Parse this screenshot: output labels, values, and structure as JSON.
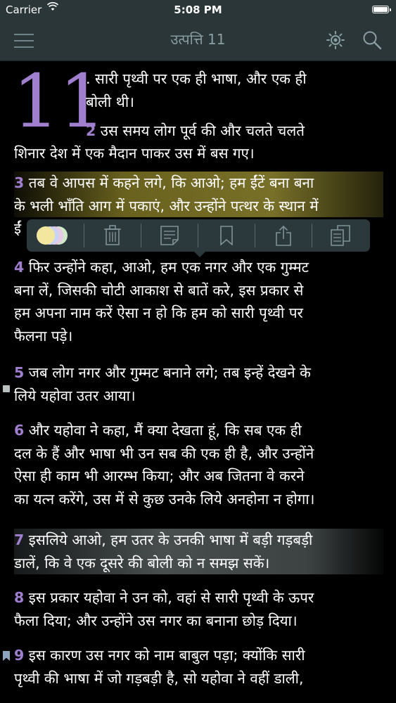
{
  "status_bar": {
    "carrier": "Carrier",
    "time": "5:08 PM"
  },
  "nav": {
    "title": "उत्पत्ति 11",
    "icons": [
      "menu-icon",
      "brightness-icon",
      "search-icon"
    ]
  },
  "chapter_number": "11",
  "verses": {
    "v1": {
      "lines": [
        ". सारी पृथ्वी पर एक ही भाषा, और एक ही",
        "बोली थी।"
      ]
    },
    "v2": {
      "num": "2",
      "lines": [
        " उस समय लोग पूर्व की और चलते चलते",
        "शिनार देश में एक मैदान पाकर उस में बस गए।"
      ]
    },
    "v3": {
      "num": "3",
      "lines": [
        " तब वे आपस में कहने लगे, कि आओ; हम ईंटें बना बना",
        "के भली भाँति आग में पकाएं, और उन्होंने पत्थर के स्थान में",
        "ईं"
      ]
    },
    "v4": {
      "num": "4",
      "lines": [
        " फिर उन्होंने कहा, आओ, हम एक नगर और एक गुम्मट",
        "बना लें, जिसकी चोटी आकाश से बातें करे, इस प्रकार से",
        "हम अपना नाम करें ऐसा न हो कि हम को सारी पृथ्वी पर",
        "फैलना पड़े।"
      ]
    },
    "v5": {
      "num": "5",
      "lines": [
        " जब लोग नगर और गुम्मट बनाने लगे; तब इन्हें देखने के",
        "लिये यहोवा उतर आया।"
      ]
    },
    "v6": {
      "num": "6",
      "lines": [
        " और यहोवा ने कहा, मैं क्या देखता हूं, कि सब एक ही",
        "दल के हैं और भाषा भी उन सब की एक ही है, और उन्होंने",
        "ऐसा ही काम भी आरम्भ किया; और अब जितना वे करने",
        "का यत्न करेंगे, उस में से कुछ उनके लिये अनहोना न होगा।"
      ]
    },
    "v7": {
      "num": "7",
      "lines": [
        " इसलिये आओ, हम उतर के उनकी भाषा में बड़ी गड़बड़ी",
        "डालें, कि वे एक दूसरे की बोली को न समझ सकें।"
      ]
    },
    "v8": {
      "num": "8",
      "lines": [
        " इस प्रकार यहोवा ने उन को, वहां से सारी पृथ्वी के ऊपर",
        "फैला दिया; और उन्होंने उस नगर का बनाना छोड़ दिया।"
      ]
    },
    "v9": {
      "num": "9",
      "lines": [
        " इस कारण उस नगर को नाम बाबुल पड़ा; क्योंकि सारी",
        "पृथ्वी की भाषा में जो गड़बड़ी है, सो यहोवा ने वहीं डाली,"
      ]
    }
  },
  "highlights": {
    "yellow": "#8c8228",
    "gray": "#7a8484"
  },
  "toolbar": {
    "buttons": [
      "color-palette-icon",
      "trash-icon",
      "note-icon",
      "bookmark-icon",
      "share-icon",
      "copy-icon"
    ],
    "dot_colors": [
      "#f3e7a0",
      "#c9d3f2",
      "#e7c9e6",
      "#cfe9c9"
    ]
  },
  "colors": {
    "accent": "#a07fcf",
    "bar": "#2a3638"
  }
}
